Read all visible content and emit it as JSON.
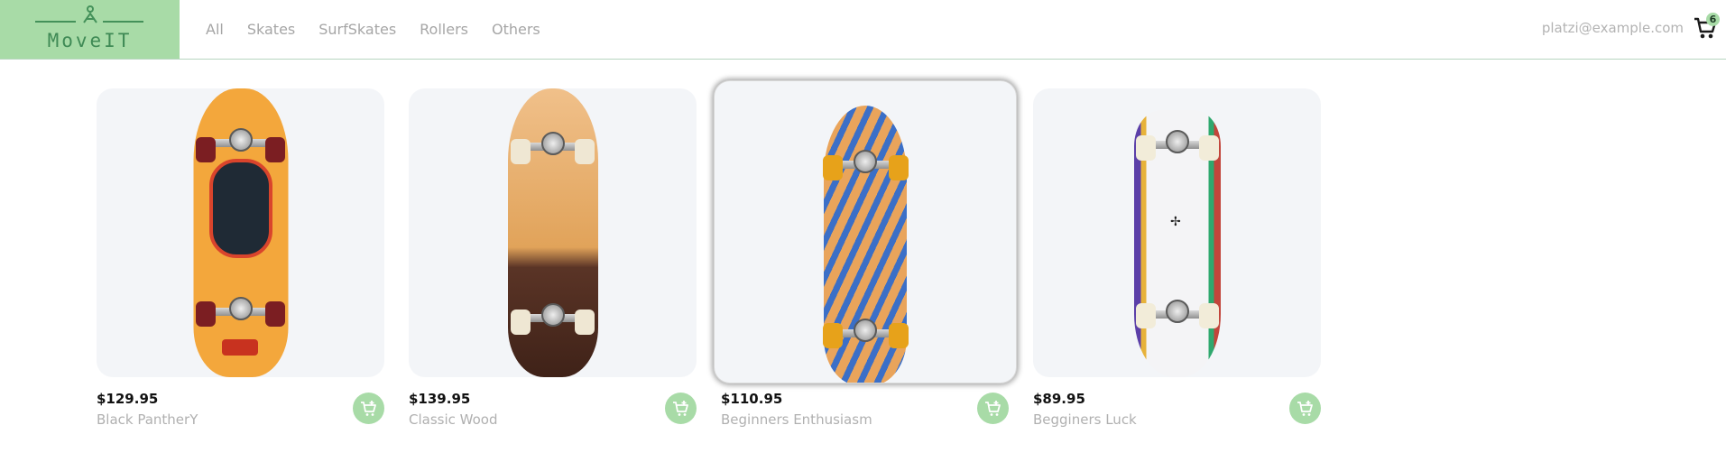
{
  "brand": {
    "name": "MoveIT",
    "accent": "#a8dba7"
  },
  "nav": {
    "items": [
      {
        "label": "All"
      },
      {
        "label": "Skates"
      },
      {
        "label": "SurfSkates"
      },
      {
        "label": "Rollers"
      },
      {
        "label": "Others"
      }
    ]
  },
  "user": {
    "email": "platzi@example.com"
  },
  "cart": {
    "count": "6",
    "icon": "shopping-cart-icon"
  },
  "products": [
    {
      "price": "$129.95",
      "name": "Black PantherY",
      "deck_color": "#f3a73c",
      "wheel_color": "#7b1e22"
    },
    {
      "price": "$139.95",
      "name": "Classic Wood",
      "deck_color": "#e8a85a",
      "wheel_color": "#efe7d3"
    },
    {
      "price": "$110.95",
      "name": "Beginners Enthusiasm",
      "deck_color": "#e9a45b",
      "wheel_color": "#e7a21a",
      "selected": true
    },
    {
      "price": "$89.95",
      "name": "Begginers Luck",
      "deck_color": "#f4f4f6",
      "wheel_color": "#f2ecd9"
    }
  ]
}
